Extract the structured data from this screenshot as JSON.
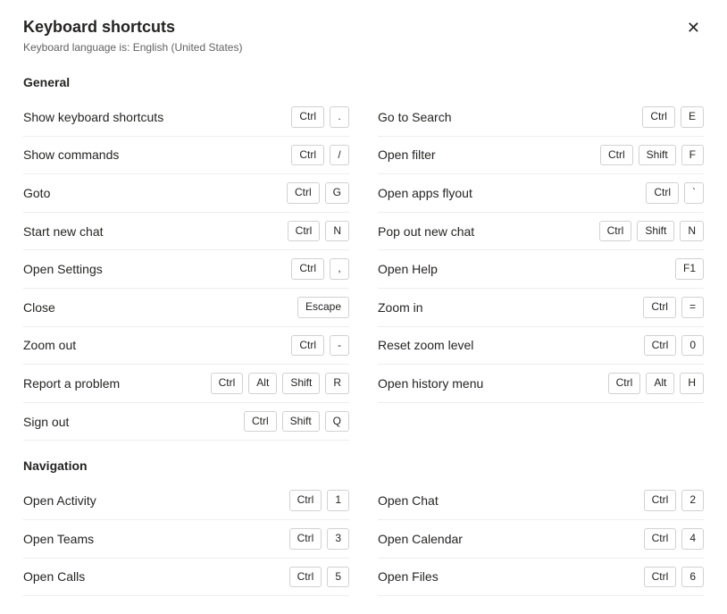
{
  "header": {
    "title": "Keyboard shortcuts",
    "subtitle": "Keyboard language is: English (United States)"
  },
  "sections": [
    {
      "title": "General",
      "left": [
        {
          "label": "Show keyboard shortcuts",
          "keys": [
            "Ctrl",
            "."
          ]
        },
        {
          "label": "Show commands",
          "keys": [
            "Ctrl",
            "/"
          ]
        },
        {
          "label": "Goto",
          "keys": [
            "Ctrl",
            "G"
          ]
        },
        {
          "label": "Start new chat",
          "keys": [
            "Ctrl",
            "N"
          ]
        },
        {
          "label": "Open Settings",
          "keys": [
            "Ctrl",
            ","
          ]
        },
        {
          "label": "Close",
          "keys": [
            "Escape"
          ]
        },
        {
          "label": "Zoom out",
          "keys": [
            "Ctrl",
            "-"
          ]
        },
        {
          "label": "Report a problem",
          "keys": [
            "Ctrl",
            "Alt",
            "Shift",
            "R"
          ]
        },
        {
          "label": "Sign out",
          "keys": [
            "Ctrl",
            "Shift",
            "Q"
          ]
        }
      ],
      "right": [
        {
          "label": "Go to Search",
          "keys": [
            "Ctrl",
            "E"
          ]
        },
        {
          "label": "Open filter",
          "keys": [
            "Ctrl",
            "Shift",
            "F"
          ]
        },
        {
          "label": "Open apps flyout",
          "keys": [
            "Ctrl",
            "`"
          ]
        },
        {
          "label": "Pop out new chat",
          "keys": [
            "Ctrl",
            "Shift",
            "N"
          ]
        },
        {
          "label": "Open Help",
          "keys": [
            "F1"
          ]
        },
        {
          "label": "Zoom in",
          "keys": [
            "Ctrl",
            "="
          ]
        },
        {
          "label": "Reset zoom level",
          "keys": [
            "Ctrl",
            "0"
          ]
        },
        {
          "label": "Open history menu",
          "keys": [
            "Ctrl",
            "Alt",
            "H"
          ]
        }
      ]
    },
    {
      "title": "Navigation",
      "left": [
        {
          "label": "Open Activity",
          "keys": [
            "Ctrl",
            "1"
          ]
        },
        {
          "label": "Open Teams",
          "keys": [
            "Ctrl",
            "3"
          ]
        },
        {
          "label": "Open Calls",
          "keys": [
            "Ctrl",
            "5"
          ]
        }
      ],
      "right": [
        {
          "label": "Open Chat",
          "keys": [
            "Ctrl",
            "2"
          ]
        },
        {
          "label": "Open Calendar",
          "keys": [
            "Ctrl",
            "4"
          ]
        },
        {
          "label": "Open Files",
          "keys": [
            "Ctrl",
            "6"
          ]
        }
      ]
    }
  ]
}
